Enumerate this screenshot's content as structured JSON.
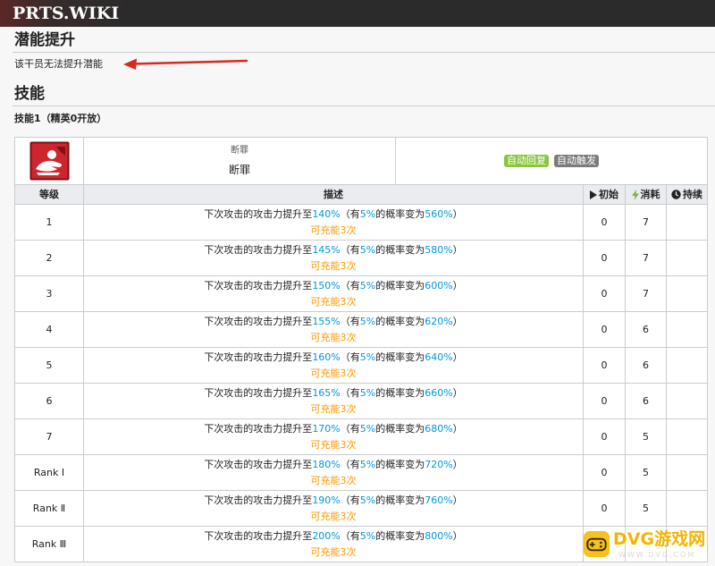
{
  "header": {
    "site_title": "PRTS.WIKI"
  },
  "potential": {
    "heading": "潜能提升",
    "text": "该干员无法提升潜能"
  },
  "skills": {
    "heading": "技能",
    "skill1_title": "技能1（精英0开放）",
    "skill1": {
      "icon": "skill-icon",
      "name_small": "断罪",
      "name": "断罪",
      "badges": {
        "recovery": {
          "label": "自动回复",
          "color": "#8bc53f"
        },
        "trigger": {
          "label": "自动触发",
          "color": "#7b7b7b"
        }
      },
      "columns": {
        "level": "等级",
        "description": "描述",
        "initial": "初始",
        "cost": "消耗",
        "duration": "持续"
      },
      "column_icons": {
        "initial": "play-icon",
        "cost": "lightning-bolt-icon",
        "duration": "clock-icon"
      },
      "desc_parts": {
        "p1": "下次攻击的攻击力提升至",
        "p2": "（有",
        "p3": "的概率变为",
        "p4": "）"
      },
      "levels": [
        {
          "level": "1",
          "atk": "140%",
          "prob": "5%",
          "crit": "560%",
          "charges": "可充能3次",
          "initial": "0",
          "cost": "7"
        },
        {
          "level": "2",
          "atk": "145%",
          "prob": "5%",
          "crit": "580%",
          "charges": "可充能3次",
          "initial": "0",
          "cost": "7"
        },
        {
          "level": "3",
          "atk": "150%",
          "prob": "5%",
          "crit": "600%",
          "charges": "可充能3次",
          "initial": "0",
          "cost": "7"
        },
        {
          "level": "4",
          "atk": "155%",
          "prob": "5%",
          "crit": "620%",
          "charges": "可充能3次",
          "initial": "0",
          "cost": "6"
        },
        {
          "level": "5",
          "atk": "160%",
          "prob": "5%",
          "crit": "640%",
          "charges": "可充能3次",
          "initial": "0",
          "cost": "6"
        },
        {
          "level": "6",
          "atk": "165%",
          "prob": "5%",
          "crit": "660%",
          "charges": "可充能3次",
          "initial": "0",
          "cost": "6"
        },
        {
          "level": "7",
          "atk": "170%",
          "prob": "5%",
          "crit": "680%",
          "charges": "可充能3次",
          "initial": "0",
          "cost": "5"
        },
        {
          "level": "Rank Ⅰ",
          "atk": "180%",
          "prob": "5%",
          "crit": "720%",
          "charges": "可充能3次",
          "initial": "0",
          "cost": "5"
        },
        {
          "level": "Rank Ⅱ",
          "atk": "190%",
          "prob": "5%",
          "crit": "760%",
          "charges": "可充能3次",
          "initial": "0",
          "cost": "5"
        },
        {
          "level": "Rank Ⅲ",
          "atk": "200%",
          "prob": "5%",
          "crit": "800%",
          "charges": "可充能3次"
        }
      ]
    }
  },
  "colors": {
    "value_blue": "#0098dc",
    "charges_orange": "#ff9900",
    "arrow_red": "#d42a20",
    "bolt_green": "#7cb342"
  },
  "watermark": {
    "brand": "DVG游戏网",
    "url": "WWW.DVG.COM"
  }
}
